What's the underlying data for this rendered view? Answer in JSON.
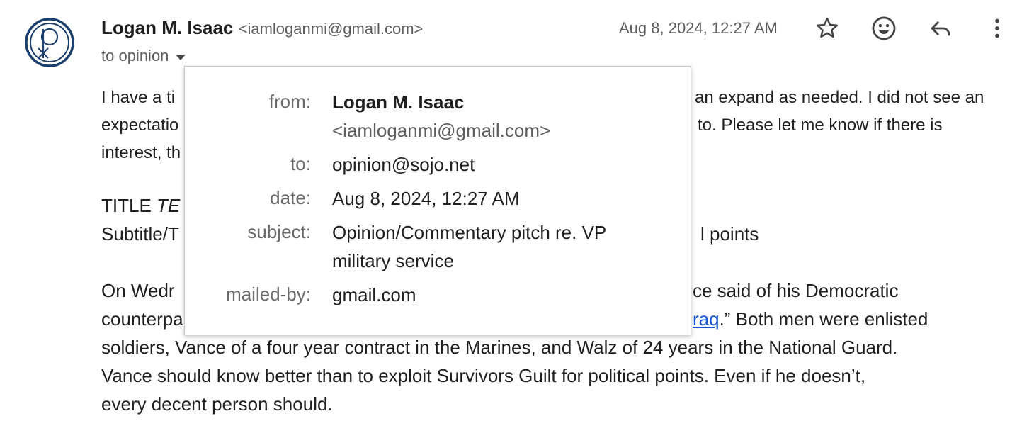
{
  "message": {
    "sender_name": "Logan M. Isaac",
    "sender_email": "<iamloganmi@gmail.com>",
    "recipients_text": "to opinion",
    "date": "Aug 8, 2024, 12:27 AM"
  },
  "icons": {
    "star": "star-icon",
    "emoji": "emoji-icon",
    "reply": "reply-icon",
    "more": "more-vert-icon",
    "avatar": "chi-rho-logo",
    "caret": "caret-down-icon"
  },
  "body": {
    "p1_line1_left": "I have a ti",
    "p1_line1_right": "an expand as needed. I did not see an",
    "p1_line2_left": "expectatio",
    "p1_line2_right": "to. Please let me know if there is",
    "p1_line3_left": "interest, th",
    "title_prefix": "TITLE ",
    "title_italic": "TE",
    "subtitle_left": "Subtitle/T",
    "subtitle_right": "l points",
    "p3_line1_left": "On Wedr",
    "p3_line1_right": "ce said of his Democratic",
    "p3_line2_left": "counterpa",
    "p3_line2_link": "raq",
    "p3_line2_right": ".” Both men were enlisted",
    "p3_line3": "soldiers, Vance of a four year contract in the Marines, and Walz of 24 years in the National Guard.",
    "p3_line4": "Vance should know better than to exploit Survivors Guilt for political points. Even if he doesn’t,",
    "p3_line5": "every decent person should."
  },
  "details_popup": {
    "from_label": "from:",
    "from_name": "Logan M. Isaac",
    "from_email": "<iamloganmi@gmail.com>",
    "to_label": "to:",
    "to_value": "opinion@sojo.net",
    "date_label": "date:",
    "date_value": "Aug 8, 2024, 12:27 AM",
    "subject_label": "subject:",
    "subject_value": "Opinion/Commentary pitch re. VP military service",
    "mailedby_label": "mailed-by:",
    "mailedby_value": "gmail.com"
  },
  "colors": {
    "link": "#1a56d8",
    "logo": "#1d3f6e"
  }
}
